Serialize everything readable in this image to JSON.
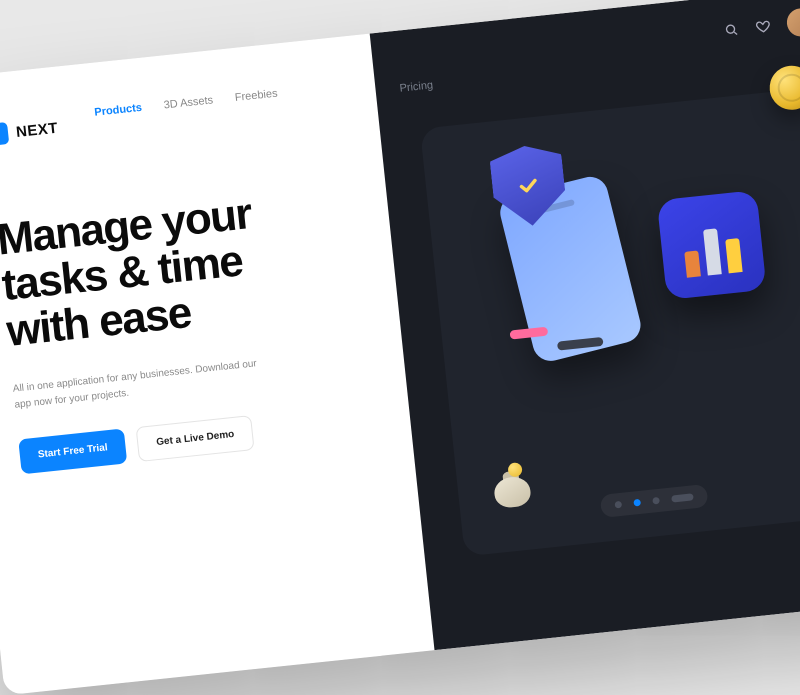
{
  "brand": {
    "name": "NEXT"
  },
  "nav": {
    "items": [
      {
        "label": "Products",
        "active": true
      },
      {
        "label": "3D Assets",
        "active": false
      },
      {
        "label": "Freebies",
        "active": false
      }
    ],
    "pricing": "Pricing"
  },
  "hero": {
    "title_l1": "Manage your",
    "title_l2": "tasks & time",
    "title_l3": "with ease",
    "subtitle": "All in one application for any businesses. Download our app now for your projects."
  },
  "cta": {
    "primary": "Start Free Trial",
    "secondary": "Get a Live Demo"
  }
}
